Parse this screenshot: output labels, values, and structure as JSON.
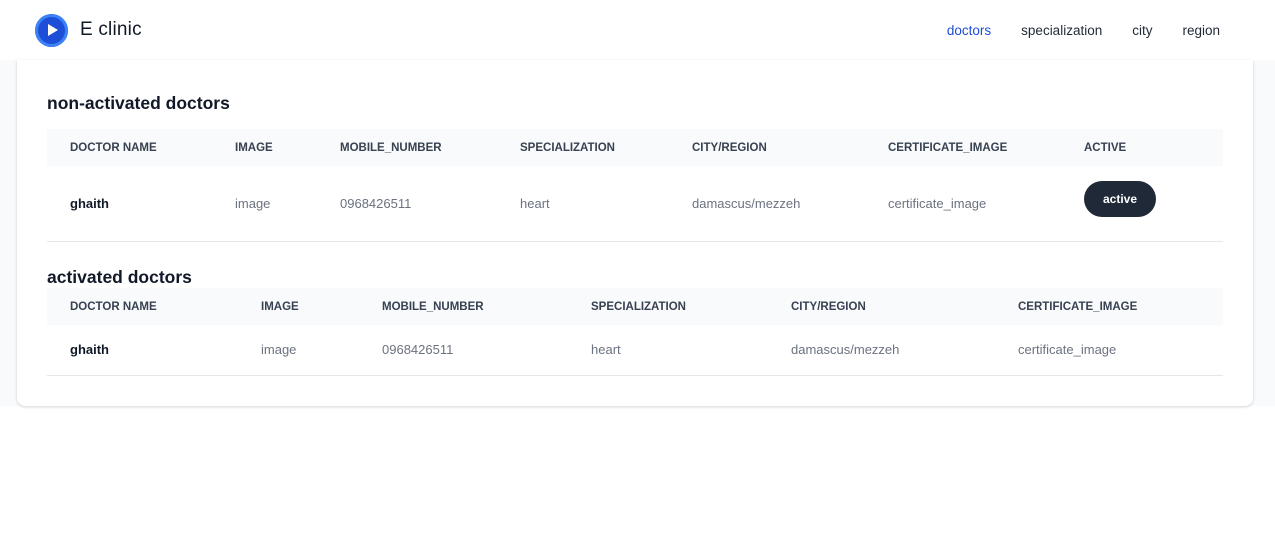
{
  "app": {
    "title": "E clinic",
    "logo_icon": "play-icon",
    "accent_color": "#1d4ed8"
  },
  "nav": {
    "items": [
      {
        "label": "doctors",
        "active": true
      },
      {
        "label": "specialization",
        "active": false
      },
      {
        "label": "city",
        "active": false
      },
      {
        "label": "region",
        "active": false
      }
    ]
  },
  "non_activated": {
    "title": "non-activated doctors",
    "columns": [
      "DOCTOR NAME",
      "IMAGE",
      "MOBILE_NUMBER",
      "SPECIALIZATION",
      "CITY/REGION",
      "CERTIFICATE_IMAGE",
      "ACTIVE"
    ],
    "rows": [
      {
        "name": "ghaith",
        "image": "image",
        "mobile": "0968426511",
        "specialization": "heart",
        "city_region": "damascus/mezzeh",
        "certificate": "certificate_image",
        "action_label": "active"
      }
    ]
  },
  "activated": {
    "title": "activated doctors",
    "columns": [
      "DOCTOR NAME",
      "IMAGE",
      "MOBILE_NUMBER",
      "SPECIALIZATION",
      "CITY/REGION",
      "CERTIFICATE_IMAGE"
    ],
    "rows": [
      {
        "name": "ghaith",
        "image": "image",
        "mobile": "0968426511",
        "specialization": "heart",
        "city_region": "damascus/mezzeh",
        "certificate": "certificate_image"
      }
    ]
  }
}
